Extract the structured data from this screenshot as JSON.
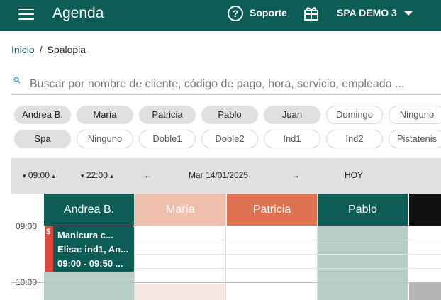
{
  "appbar": {
    "title": "Agenda",
    "support_label": "Soporte",
    "account_label": "SPA DEMO 3",
    "color": "#0d5c55",
    "icons": [
      "menu-icon",
      "help-circle-icon",
      "gift-icon",
      "caret-down-icon"
    ]
  },
  "breadcrumb": {
    "home": "Inicio",
    "separator": "/",
    "current": "Spalopia"
  },
  "search": {
    "placeholder": "Buscar por nombre de cliente, código de pago, hora, servicio, empleado ..."
  },
  "employee_chips": [
    {
      "label": "Andrea B.",
      "selected": true
    },
    {
      "label": "María",
      "selected": true
    },
    {
      "label": "Patricia",
      "selected": true
    },
    {
      "label": "Pablo",
      "selected": true
    },
    {
      "label": "Juan",
      "selected": true
    },
    {
      "label": "Domingo",
      "selected": false
    },
    {
      "label": "Ninguno",
      "selected": false
    }
  ],
  "room_chips": [
    {
      "label": "Spa",
      "selected": true
    },
    {
      "label": "Ninguno",
      "selected": false
    },
    {
      "label": "Doble1",
      "selected": false
    },
    {
      "label": "Doble2",
      "selected": false
    },
    {
      "label": "Ind1",
      "selected": false
    },
    {
      "label": "Ind2",
      "selected": false
    },
    {
      "label": "Pistatenis",
      "selected": false
    }
  ],
  "toolbar": {
    "start_time": "09:00",
    "end_time": "22:00",
    "prev_label": "←",
    "date_label": "Mar 14/01/2025",
    "next_label": "→",
    "today_label": "HOY"
  },
  "calendar": {
    "hours": [
      "09:00",
      "10:00"
    ],
    "columns": [
      {
        "name": "Andrea B.",
        "header_color": "#0d5c55",
        "body_color": "#ffffff"
      },
      {
        "name": "María",
        "header_color": "#efbfae",
        "body_color": "#ffffff"
      },
      {
        "name": "Patricia",
        "header_color": "#df7250",
        "body_color": "#ffffff"
      },
      {
        "name": "Pablo",
        "header_color": "#0d5c55",
        "body_color": "#b8cec9"
      },
      {
        "name": "",
        "header_color": "#111111",
        "body_color": "#ffffff"
      }
    ],
    "event": {
      "flag": "$",
      "title": "Manicura c...",
      "detail": "Elisa: ind1, An...",
      "time": "09:00 - 09:50 ...",
      "color": "#0d5c55",
      "flag_color": "#e14a3b"
    }
  }
}
